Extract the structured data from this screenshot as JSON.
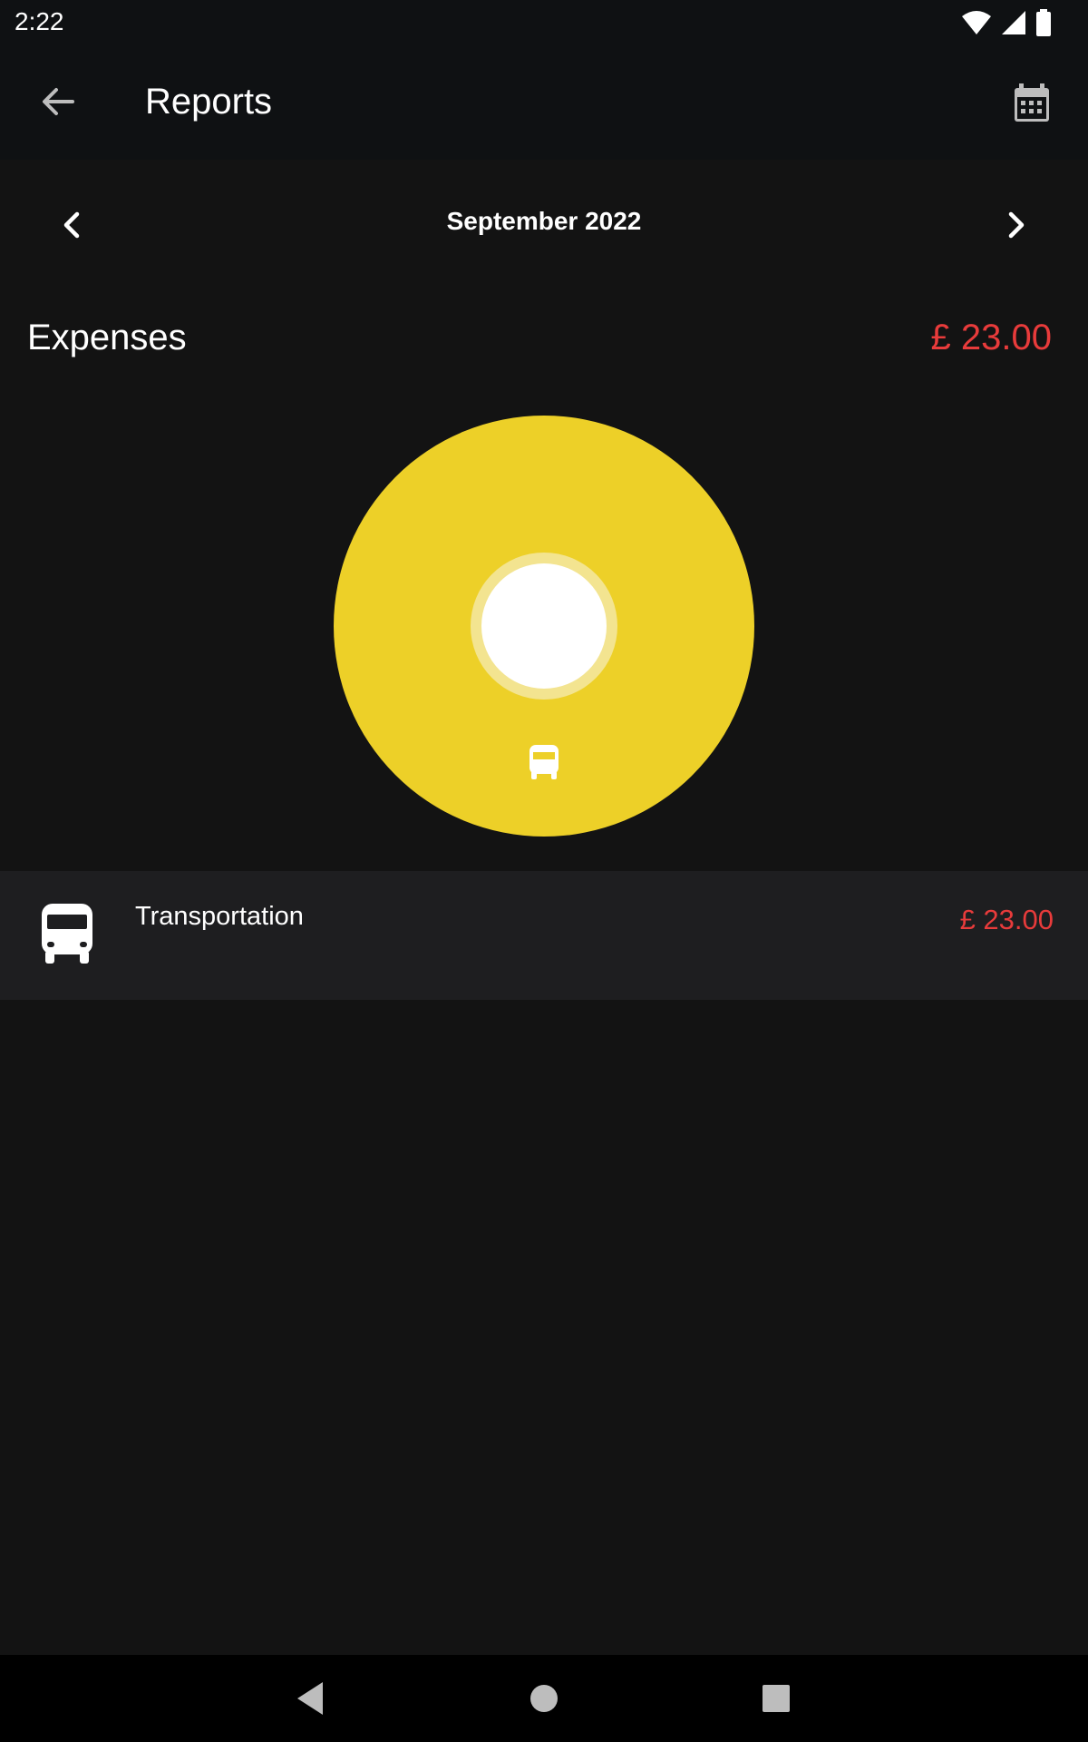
{
  "status_bar": {
    "time": "2:22",
    "icons": [
      "wifi-icon",
      "signal-icon",
      "battery-icon"
    ]
  },
  "app_bar": {
    "title": "Reports",
    "back_icon": "arrow-left-icon",
    "calendar_icon": "calendar-icon"
  },
  "month_nav": {
    "label": "September 2022",
    "prev_icon": "chevron-left-icon",
    "next_icon": "chevron-right-icon"
  },
  "expenses": {
    "title": "Expenses",
    "total": "£ 23.00",
    "total_color": "#e83b3b"
  },
  "chart_data": {
    "type": "pie",
    "categories": [
      "Transportation"
    ],
    "values": [
      23.0
    ],
    "colors": [
      "#edd028"
    ],
    "icons": [
      "bus-icon"
    ]
  },
  "categories": [
    {
      "label": "Transportation",
      "amount": "£ 23.00",
      "icon": "bus-icon"
    }
  ],
  "nav_bar": {
    "icons": [
      "nav-back-icon",
      "nav-home-icon",
      "nav-recents-icon"
    ]
  }
}
